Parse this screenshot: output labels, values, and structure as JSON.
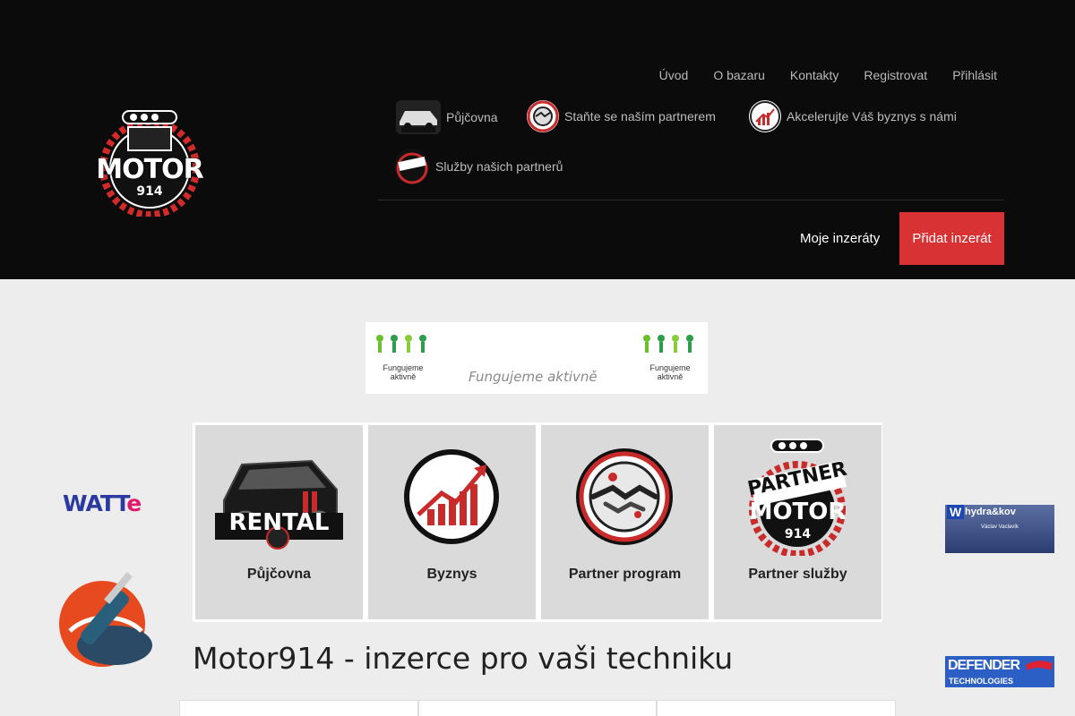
{
  "header": {
    "logo": {
      "line1": "MOTOR",
      "line2": "914"
    },
    "top_nav": [
      "Úvod",
      "O bazaru",
      "Kontakty",
      "Registrovat",
      "Přihlásit"
    ],
    "secondary_nav": [
      {
        "label": "Půjčovna",
        "icon": "rental-car-icon"
      },
      {
        "label": "Staňte se naším partnerem",
        "icon": "handshake-icon"
      },
      {
        "label": "Akcelerujte Váš byznys s námi",
        "icon": "growth-chart-icon"
      },
      {
        "label": "Služby našich partnerů",
        "icon": "partner-motor-icon"
      }
    ],
    "my_ads": "Moje inzeráty",
    "add_ad": "Přidat inzerát"
  },
  "banner": {
    "left_caption": "Fungujeme aktivně",
    "center_text": "Fungujeme aktivně",
    "right_caption": "Fungujeme aktivně"
  },
  "tiles": [
    {
      "label": "Půjčovna",
      "image": "rental-car-image",
      "image_text": "RENTAL"
    },
    {
      "label": "Byznys",
      "image": "growth-chart-image"
    },
    {
      "label": "Partner program",
      "image": "handshake-image"
    },
    {
      "label": "Partner služby",
      "image": "partner-motor-image",
      "image_text": "PARTNER",
      "image_text2": "MOTOR",
      "image_text3": "914"
    }
  ],
  "page_title": "Motor914 - inzerce pro vaši techniku",
  "side_ads": {
    "left": [
      {
        "name": "WATT",
        "accent": "e"
      },
      {
        "name": "tool-logo"
      }
    ],
    "right": [
      {
        "brand": "hydra&kov",
        "initial": "W",
        "person": "Václav Vaclavík"
      },
      {
        "brand": "DEFENDER",
        "sub": "TECHNOLOGIES"
      }
    ]
  },
  "colors": {
    "header_bg": "#0b0b0b",
    "accent_red": "#d93235",
    "page_bg": "#ededed",
    "tile_bg": "#dadada"
  }
}
